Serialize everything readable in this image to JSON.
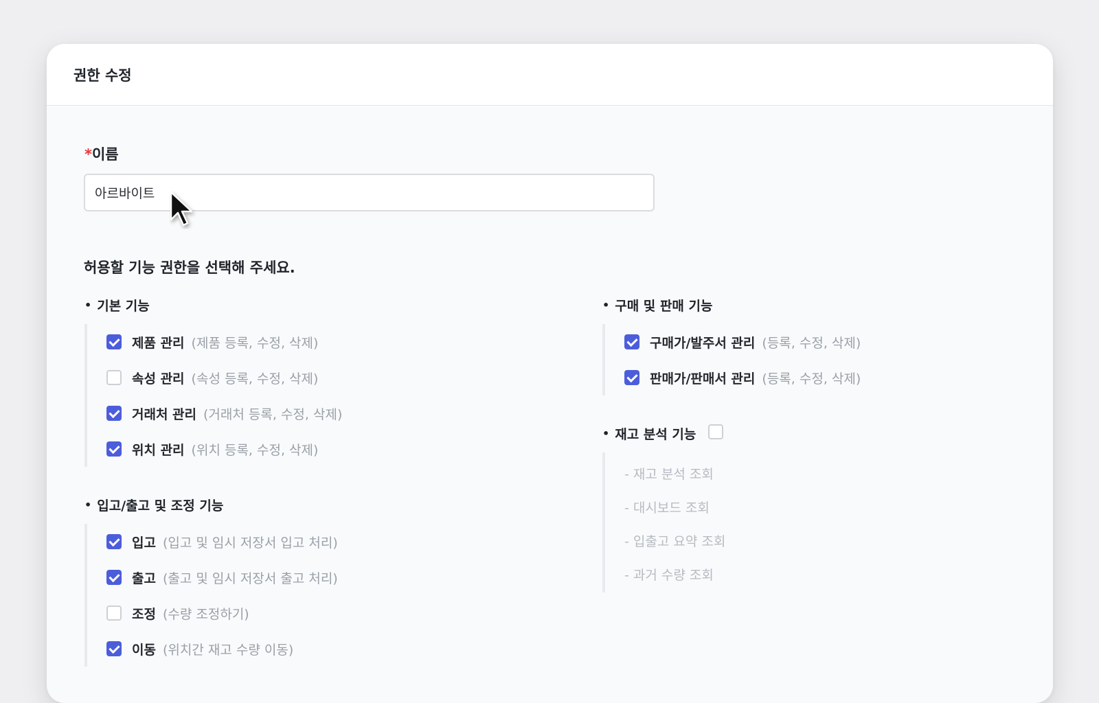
{
  "dialog": {
    "title": "권한 수정"
  },
  "name_field": {
    "required_mark": "*",
    "label": "이름",
    "value": "아르바이트"
  },
  "instruction": "허용할 기능 권한을 선택해 주세요.",
  "groups": {
    "basic": {
      "title": "기본 기능",
      "items": [
        {
          "label": "제품 관리",
          "desc": "(제품 등록, 수정, 삭제)",
          "checked": true
        },
        {
          "label": "속성 관리",
          "desc": "(속성 등록, 수정, 삭제)",
          "checked": false
        },
        {
          "label": "거래처 관리",
          "desc": "(거래처 등록, 수정, 삭제)",
          "checked": true
        },
        {
          "label": "위치 관리",
          "desc": "(위치 등록, 수정, 삭제)",
          "checked": true
        }
      ]
    },
    "inout": {
      "title": "입고/출고 및 조정 기능",
      "items": [
        {
          "label": "입고",
          "desc": "(입고 및 임시 저장서 입고 처리)",
          "checked": true
        },
        {
          "label": "출고",
          "desc": "(출고 및 임시 저장서 출고 처리)",
          "checked": true
        },
        {
          "label": "조정",
          "desc": "(수량 조정하기)",
          "checked": false
        },
        {
          "label": "이동",
          "desc": "(위치간 재고 수량 이동)",
          "checked": true
        }
      ]
    },
    "purchase": {
      "title": "구매 및 판매 기능",
      "items": [
        {
          "label": "구매가/발주서 관리",
          "desc": "(등록, 수정, 삭제)",
          "checked": true
        },
        {
          "label": "판매가/판매서 관리",
          "desc": "(등록, 수정, 삭제)",
          "checked": true
        }
      ]
    },
    "analysis": {
      "title": "재고 분석 기능",
      "checked": false,
      "items": [
        "- 재고 분석 조회",
        "- 대시보드 조회",
        "- 입출고 요약 조회",
        "- 과거 수량 조회"
      ]
    }
  },
  "colors": {
    "accent": "#4c5ddb",
    "required": "#e5383b",
    "disabled_text": "#b7bbc1"
  },
  "icons": {
    "cursor": "mouse-pointer-icon",
    "bullet": "•"
  }
}
